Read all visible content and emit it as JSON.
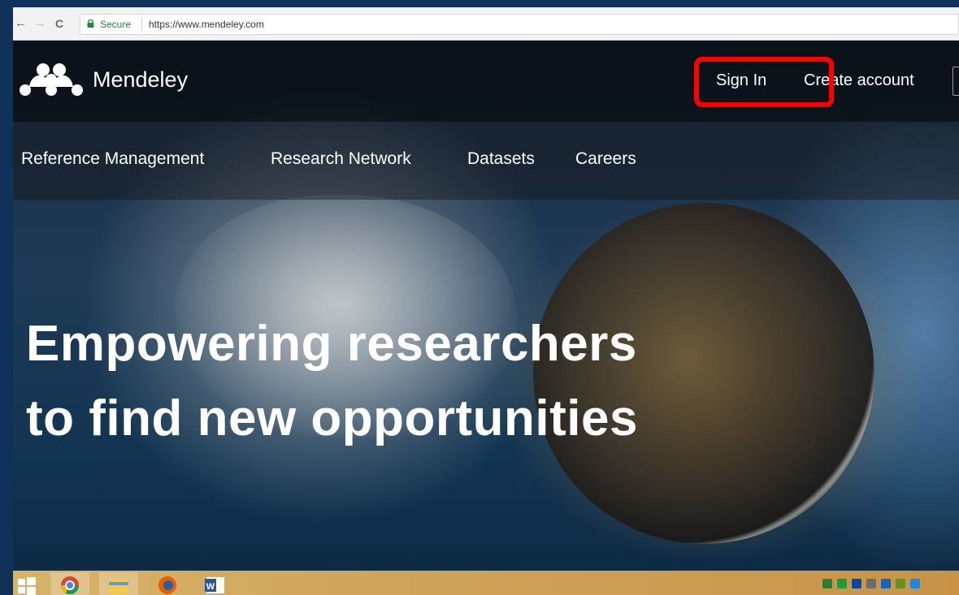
{
  "browser": {
    "back_glyph": "←",
    "forward_glyph": "→",
    "reload_glyph": "C",
    "secure_label": "Secure",
    "url": "https://www.mendeley.com"
  },
  "header": {
    "brand": "Mendeley",
    "sign_in": "Sign In",
    "create_account": "Create account"
  },
  "nav": {
    "items": [
      {
        "label": "Reference Management"
      },
      {
        "label": "Research Network"
      },
      {
        "label": "Datasets"
      },
      {
        "label": "Careers"
      }
    ]
  },
  "hero": {
    "line1": "Empowering researchers",
    "line2": "to find new opportunities"
  },
  "taskbar": {
    "apps": [
      {
        "name": "start-icon"
      },
      {
        "name": "chrome-icon"
      },
      {
        "name": "file-explorer-icon"
      },
      {
        "name": "firefox-icon"
      },
      {
        "name": "word-icon"
      }
    ],
    "tray_colors": [
      "#2f7d32",
      "#1f9a3a",
      "#0d47a1",
      "#6b6b6b",
      "#1565c0",
      "#6b8e23",
      "#1e88e5"
    ]
  },
  "colors": {
    "highlight": "#ff0000",
    "secure_green": "#1f8a3b"
  }
}
